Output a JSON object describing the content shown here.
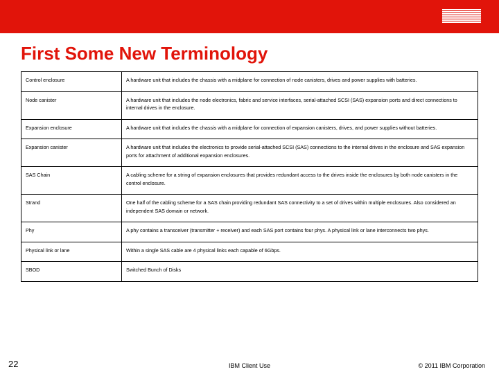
{
  "brand": {
    "name": "IBM"
  },
  "title": "First Some New Terminology",
  "rows": [
    {
      "term": "Control enclosure",
      "def": "A hardware unit that includes the chassis with a midplane for connection of node canisters, drives and power supplies with batteries."
    },
    {
      "term": "Node canister",
      "def": "A hardware unit that includes the node electronics, fabric and service interfaces, serial-attached SCSI (SAS) expansion ports and direct connections to internal drives in the enclosure."
    },
    {
      "term": "Expansion enclosure",
      "def": "A hardware unit that includes the chassis with a midplane for connection of expansion canisters, drives, and power supplies without batteries."
    },
    {
      "term": "Expansion canister",
      "def": "A hardware unit that includes the electronics to provide serial-attached SCSI (SAS) connections to the internal drives in the enclosure and SAS expansion ports for attachment of additional expansion enclosures."
    },
    {
      "term": "SAS Chain",
      "def": "A cabling scheme for a string of expansion enclosures that provides redundant access to the drives inside the enclosures by both node canisters in the control enclosure."
    },
    {
      "term": "Strand",
      "def": "One half of the cabling scheme for a SAS chain providing redundant SAS connectivity to a set of drives within multiple enclosures. Also considered an independent SAS domain or network."
    },
    {
      "term": "Phy",
      "def": "A phy contains a transceiver (transmitter + receiver) and each SAS port contains four phys. A physical link or lane interconnects two phys."
    },
    {
      "term": "Physical link or lane",
      "def": "Within a single SAS cable are 4 physical links each capable of 6Gbps."
    },
    {
      "term": "SBOD",
      "def": "Switched Bunch of Disks"
    }
  ],
  "footer": {
    "page_number": "22",
    "center": "IBM Client Use",
    "copyright": "© 2011 IBM Corporation"
  }
}
